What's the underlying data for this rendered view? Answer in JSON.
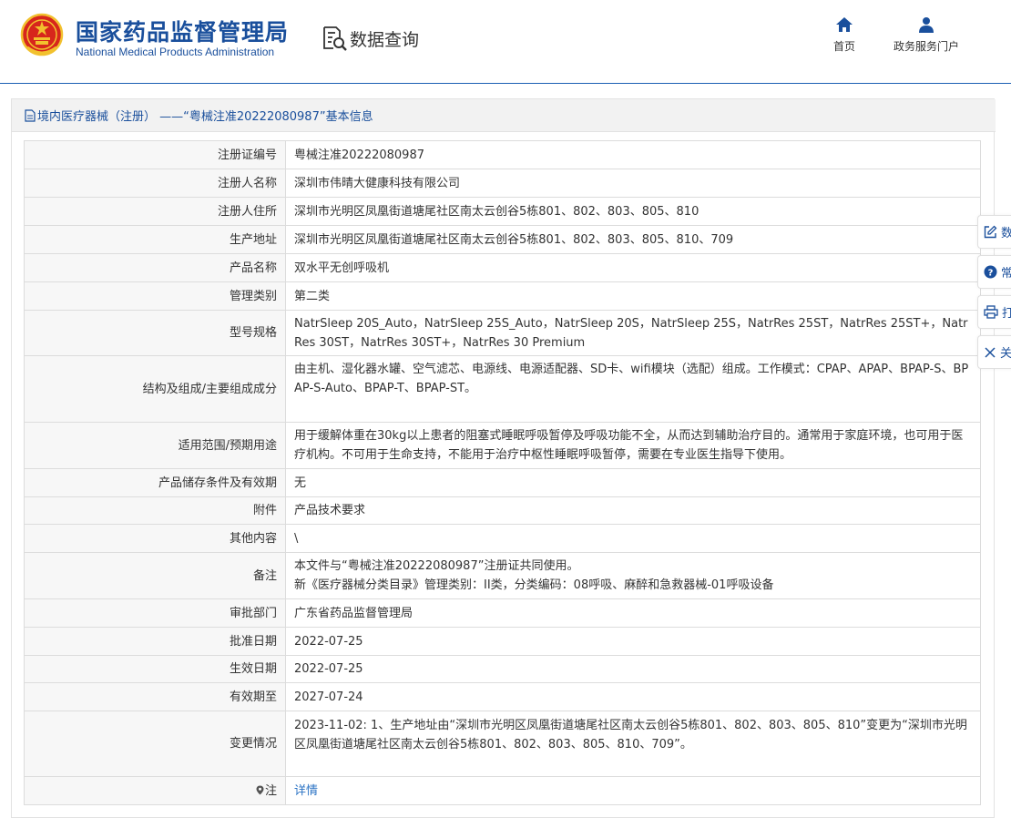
{
  "header": {
    "org_name_cn": "国家药品监督管理局",
    "org_name_en": "National Medical Products Administration",
    "query_label": "数据查询",
    "nav": [
      {
        "label": "首页",
        "icon": "home-icon"
      },
      {
        "label": "政务服务门户",
        "icon": "user-icon"
      }
    ]
  },
  "panel": {
    "title": "境内医疗器械（注册） ——“粤械注准20222080987”基本信息"
  },
  "rows": [
    {
      "label": "注册证编号",
      "value": "粤械注准20222080987"
    },
    {
      "label": "注册人名称",
      "value": "深圳市伟晴大健康科技有限公司"
    },
    {
      "label": "注册人住所",
      "value": "深圳市光明区凤凰街道塘尾社区南太云创谷5栋801、802、803、805、810"
    },
    {
      "label": "生产地址",
      "value": "深圳市光明区凤凰街道塘尾社区南太云创谷5栋801、802、803、805、810、709"
    },
    {
      "label": "产品名称",
      "value": "双水平无创呼吸机"
    },
    {
      "label": "管理类别",
      "value": "第二类"
    },
    {
      "label": "型号规格",
      "value": "NatrSleep 20S_Auto，NatrSleep 25S_Auto，NatrSleep 20S，NatrSleep 25S，NatrRes 25ST，NatrRes 25ST+，NatrRes 30ST，NatrRes 30ST+，NatrRes 30 Premium"
    },
    {
      "label": "结构及组成/主要组成成分",
      "value": "由主机、湿化器水罐、空气滤芯、电源线、电源适配器、SD卡、wifi模块（选配）组成。工作模式：CPAP、APAP、BPAP-S、BPAP-S-Auto、BPAP-T、BPAP-ST。"
    },
    {
      "label": "适用范围/预期用途",
      "value": "用于缓解体重在30kg以上患者的阻塞式睡眠呼吸暂停及呼吸功能不全，从而达到辅助治疗目的。通常用于家庭环境，也可用于医疗机构。不可用于生命支持，不能用于治疗中枢性睡眠呼吸暂停，需要在专业医生指导下使用。"
    },
    {
      "label": "产品储存条件及有效期",
      "value": "无"
    },
    {
      "label": "附件",
      "value": "产品技术要求"
    },
    {
      "label": "其他内容",
      "value": "\\"
    },
    {
      "label": "备注",
      "value": "本文件与“粤械注准20222080987”注册证共同使用。",
      "value2": "新《医疗器械分类目录》管理类别：II类，分类编码：08呼吸、麻醉和急救器械-01呼吸设备"
    },
    {
      "label": "审批部门",
      "value": "广东省药品监督管理局"
    },
    {
      "label": "批准日期",
      "value": "2022-07-25"
    },
    {
      "label": "生效日期",
      "value": "2022-07-25"
    },
    {
      "label": "有效期至",
      "value": "2027-07-24"
    },
    {
      "label": "变更情况",
      "value": "2023-11-02: 1、生产地址由“深圳市光明区凤凰街道塘尾社区南太云创谷5栋801、802、803、805、810”变更为“深圳市光明区凤凰街道塘尾社区南太云创谷5栋801、802、803、805、810、709”。"
    },
    {
      "label": "注",
      "value": "详情"
    }
  ],
  "float_bar": [
    {
      "label": "数",
      "icon": "edit-icon"
    },
    {
      "label": "常",
      "icon": "help-icon"
    },
    {
      "label": "打",
      "icon": "print-icon"
    },
    {
      "label": "关",
      "icon": "close-icon"
    }
  ],
  "colors": {
    "brand": "#1a4f9c",
    "link": "#2b73c4",
    "emblem_red": "#d7261c",
    "emblem_gold": "#f2c12e"
  }
}
